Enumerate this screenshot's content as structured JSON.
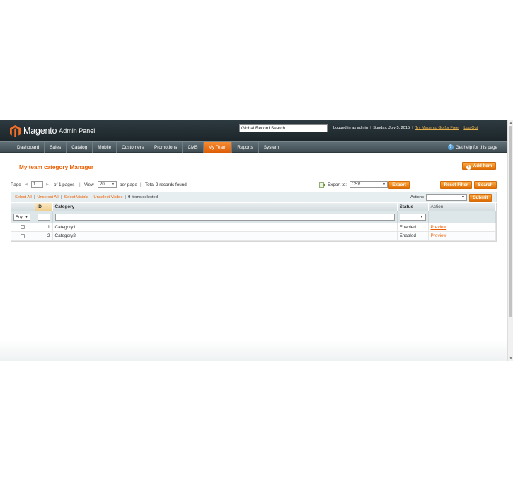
{
  "brand": {
    "name": "Magento",
    "sub": "Admin Panel",
    "color": "#f46f25"
  },
  "header": {
    "search_value": "Global Record Search",
    "logged_in": "Logged in as admin",
    "date": "Sunday, July 5, 2015",
    "try_go": "Try Magento Go for Free",
    "logout": "Log Out"
  },
  "nav": {
    "items": [
      "Dashboard",
      "Sales",
      "Catalog",
      "Mobile",
      "Customers",
      "Promotions",
      "CMS",
      "My Team",
      "Reports",
      "System"
    ],
    "active": "My Team",
    "help": "Get help for this page"
  },
  "page": {
    "title": "My team category Manager",
    "add_button": "Add Item"
  },
  "pager": {
    "page_label": "Page",
    "page_value": "1",
    "of_pages": "of 1 pages",
    "view_label": "View",
    "view_value": "20",
    "per_page": "per page",
    "total": "Total 2 records found",
    "export_label": "Export to:",
    "export_value": "CSV",
    "export_button": "Export",
    "reset_button": "Reset Filter",
    "search_button": "Search"
  },
  "massaction": {
    "select_all": "Select All",
    "unselect_all": "Unselect All",
    "select_visible": "Select Visible",
    "unselect_visible": "Unselect Visible",
    "selected_count": "0",
    "selected_text": "items selected",
    "actions_label": "Actions",
    "submit": "Submit"
  },
  "grid": {
    "columns": [
      "ID",
      "Category",
      "Status",
      "Action"
    ],
    "filter_any": "Any",
    "rows": [
      {
        "id": "1",
        "category": "Category1",
        "status": "Enabled",
        "action": "Preview"
      },
      {
        "id": "2",
        "category": "Category2",
        "status": "Enabled",
        "action": "Preview"
      }
    ]
  }
}
